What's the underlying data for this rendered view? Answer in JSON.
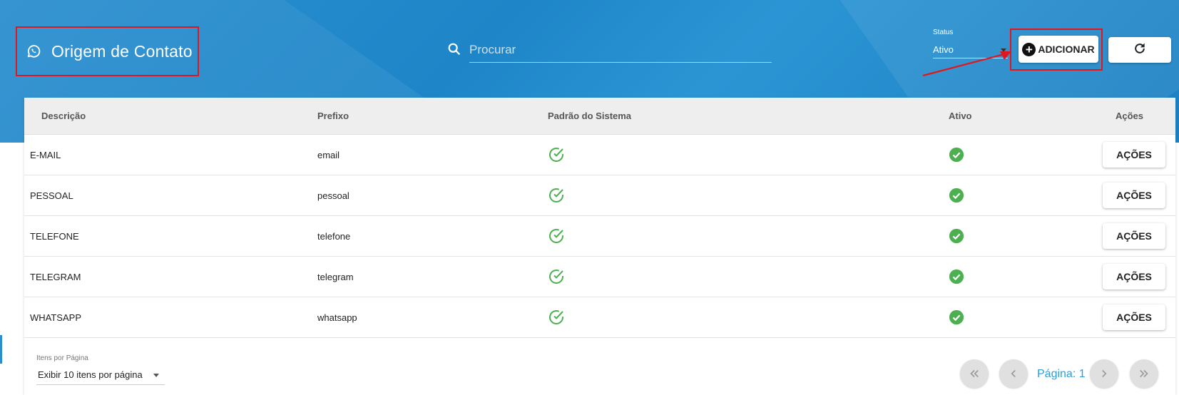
{
  "header": {
    "title": "Origem de Contato",
    "search_placeholder": "Procurar",
    "status_label": "Status",
    "status_value": "Ativo",
    "add_label": "ADICIONAR"
  },
  "table": {
    "columns": [
      "Descrição",
      "Prefixo",
      "Padrão do Sistema",
      "Ativo",
      "Ações"
    ],
    "rows": [
      {
        "descricao": "E-MAIL",
        "prefixo": "email",
        "padrao": true,
        "ativo": true,
        "acoes": "AÇÕES"
      },
      {
        "descricao": "PESSOAL",
        "prefixo": "pessoal",
        "padrao": true,
        "ativo": true,
        "acoes": "AÇÕES"
      },
      {
        "descricao": "TELEFONE",
        "prefixo": "telefone",
        "padrao": true,
        "ativo": true,
        "acoes": "AÇÕES"
      },
      {
        "descricao": "TELEGRAM",
        "prefixo": "telegram",
        "padrao": true,
        "ativo": true,
        "acoes": "AÇÕES"
      },
      {
        "descricao": "WHATSAPP",
        "prefixo": "whatsapp",
        "padrao": true,
        "ativo": true,
        "acoes": "AÇÕES"
      }
    ]
  },
  "footer": {
    "per_page_label": "Itens por Página",
    "per_page_value": "Exibir 10 itens por página",
    "page_label": "Página: 1"
  },
  "icons": {
    "title": "whatsapp-icon",
    "search": "search-icon",
    "add": "plus-circle-icon",
    "refresh": "refresh-icon",
    "padrao": "check-circle-outline-icon",
    "ativo": "check-circle-filled-icon"
  },
  "colors": {
    "header_bg": "#1e86c8",
    "highlight": "#e0181e",
    "check_green": "#4caf50",
    "page_link": "#2a9fd8"
  }
}
